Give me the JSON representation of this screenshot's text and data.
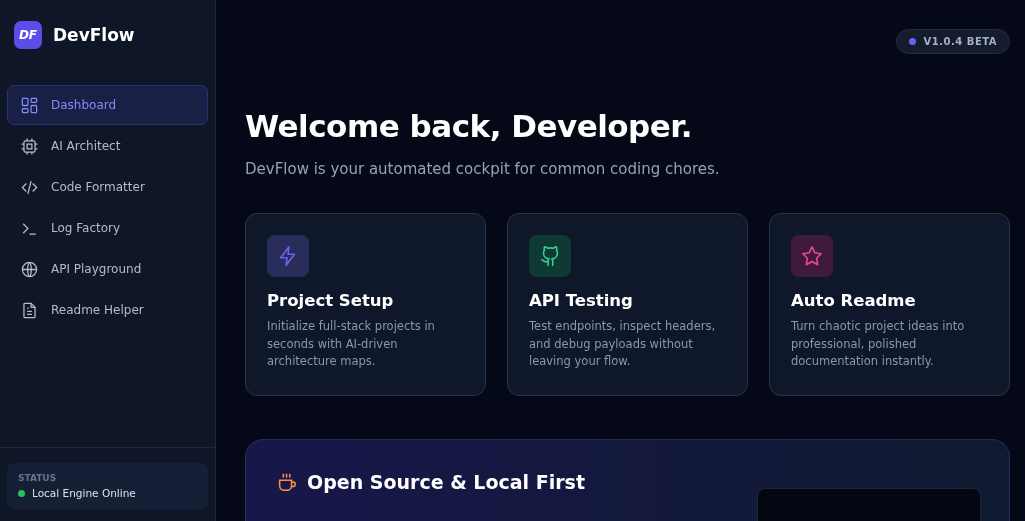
{
  "brand": {
    "logo": "DF",
    "name": "DevFlow"
  },
  "sidebar": {
    "items": [
      {
        "label": "Dashboard",
        "selected": true
      },
      {
        "label": "AI Architect",
        "selected": false
      },
      {
        "label": "Code Formatter",
        "selected": false
      },
      {
        "label": "Log Factory",
        "selected": false
      },
      {
        "label": "API Playground",
        "selected": false
      },
      {
        "label": "Readme Helper",
        "selected": false
      }
    ],
    "status": {
      "heading": "STATUS",
      "text": "Local Engine Online"
    }
  },
  "version_badge": "V1.0.4 BETA",
  "heading": "Welcome back, Developer.",
  "subtitle": "DevFlow is your automated cockpit for common coding chores.",
  "cards": [
    {
      "title": "Project Setup",
      "text": "Initialize full-stack projects in seconds with AI-driven architecture maps."
    },
    {
      "title": "API Testing",
      "text": "Test endpoints, inspect headers, and debug payloads without leaving your flow."
    },
    {
      "title": "Auto Readme",
      "text": "Turn chaotic project ideas into professional, polished documentation instantly."
    }
  ],
  "banner": {
    "title": "Open Source & Local First"
  }
}
